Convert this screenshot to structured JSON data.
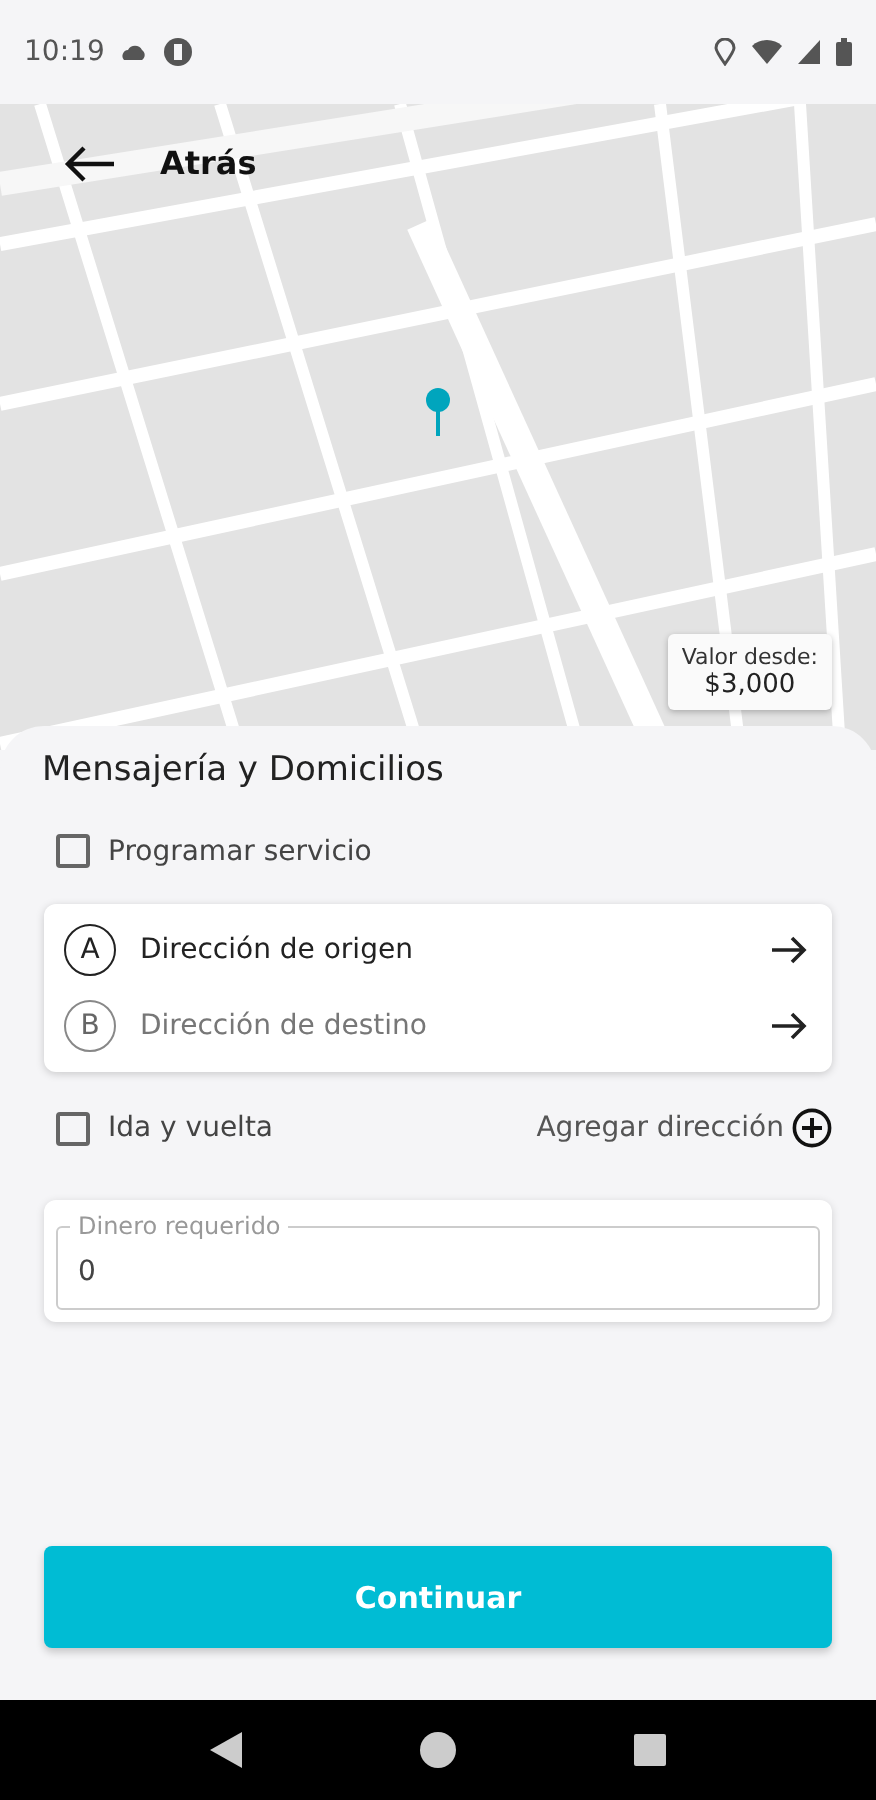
{
  "status_bar": {
    "time": "10:19"
  },
  "header": {
    "back_label": "Atrás"
  },
  "map": {
    "kind": "picture",
    "price_badge": {
      "label": "Valor desde:",
      "value": "$3,000"
    }
  },
  "sheet": {
    "title": "Mensajería y Domicilios",
    "schedule": {
      "label": "Programar servicio",
      "checked": false
    },
    "addresses": [
      {
        "letter": "A",
        "text": "Dirección de origen",
        "filled": true
      },
      {
        "letter": "B",
        "text": "Dirección de destino",
        "filled": false
      }
    ],
    "round_trip": {
      "label": "Ida y vuelta",
      "checked": false
    },
    "add_address": "Agregar dirección",
    "money_field": {
      "label": "Dinero requerido",
      "value": "0"
    },
    "continue_button": "Continuar"
  }
}
